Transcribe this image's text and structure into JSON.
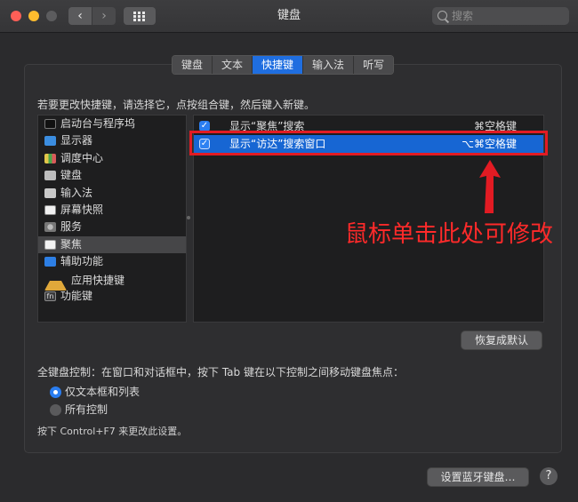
{
  "window": {
    "title": "键盘",
    "search_placeholder": "搜索",
    "nav_back": "‹",
    "nav_forward": "›"
  },
  "tabs": [
    {
      "label": "键盘",
      "active": false
    },
    {
      "label": "文本",
      "active": false
    },
    {
      "label": "快捷键",
      "active": true
    },
    {
      "label": "输入法",
      "active": false
    },
    {
      "label": "听写",
      "active": false
    }
  ],
  "instruction": "若要更改快捷键，请选择它，点按组合键，然后键入新键。",
  "categories": [
    {
      "label": "启动台与程序坞",
      "icon": "launchpad-icon"
    },
    {
      "label": "显示器",
      "icon": "display-icon"
    },
    {
      "label": "调度中心",
      "icon": "mission-control-icon"
    },
    {
      "label": "键盘",
      "icon": "keyboard-icon"
    },
    {
      "label": "输入法",
      "icon": "input-source-icon"
    },
    {
      "label": "屏幕快照",
      "icon": "screenshot-icon"
    },
    {
      "label": "服务",
      "icon": "services-gear-icon"
    },
    {
      "label": "聚焦",
      "icon": "spotlight-icon",
      "selected": true
    },
    {
      "label": "辅助功能",
      "icon": "accessibility-icon"
    },
    {
      "label": "应用快捷键",
      "icon": "app-shortcuts-icon"
    },
    {
      "label": "功能键",
      "icon": "fn-key-icon",
      "icon_text": "fn"
    }
  ],
  "shortcuts": [
    {
      "enabled": true,
      "name": "显示“聚焦”搜索",
      "key": "⌘空格键",
      "selected": false
    },
    {
      "enabled": true,
      "name": "显示“访达”搜索窗口",
      "key": "⌥⌘空格键",
      "selected": true
    }
  ],
  "checkmark": "✓",
  "annotation": "鼠标单击此处可修改",
  "annotation_color": "#e21b23",
  "restore_button": "恢复成默认",
  "full_keyboard_label": "全键盘控制：在窗口和对话框中，按下 Tab 键在以下控制之间移动键盘焦点：",
  "radio_options": [
    {
      "label": "仅文本框和列表",
      "checked": true
    },
    {
      "label": "所有控制",
      "checked": false
    }
  ],
  "note": "按下 Control+F7 来更改此设置。",
  "bluetooth_button": "设置蓝牙键盘…",
  "help_button": "?",
  "accent_color": "#1f6ee0"
}
